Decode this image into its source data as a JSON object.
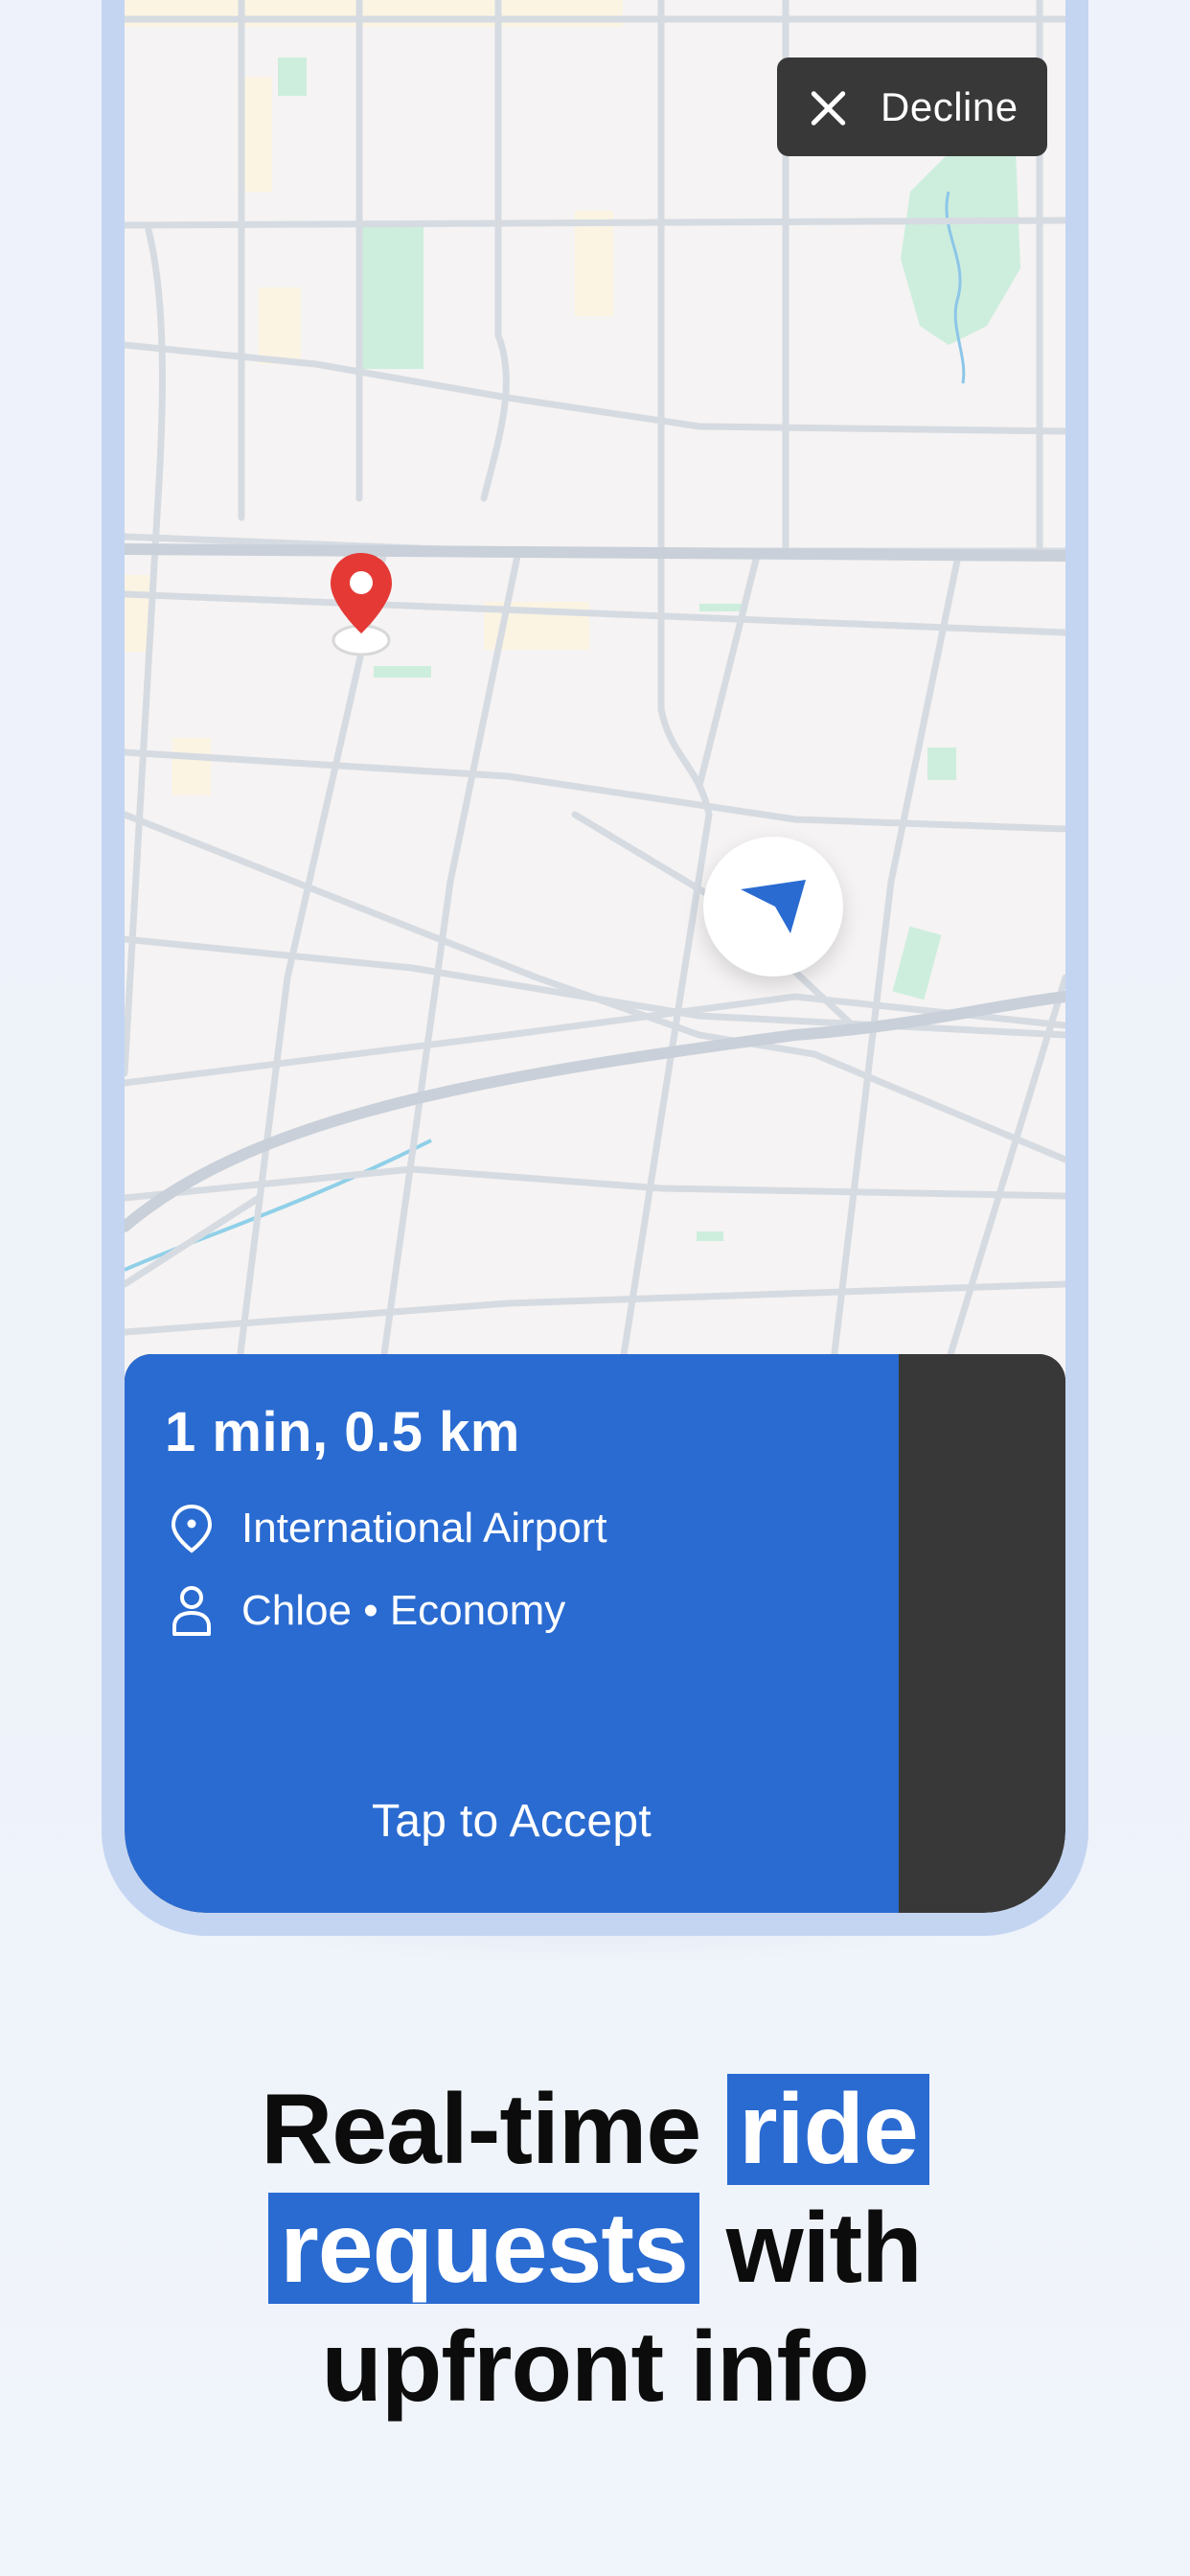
{
  "map": {
    "decline_label": "Decline",
    "icons": {
      "decline": "close-icon",
      "pickup_pin": "map-pin-icon",
      "recenter": "navigation-arrow-icon"
    }
  },
  "request_card": {
    "eta": "1 min, 0.5 km",
    "destination": "International Airport",
    "rider": "Chloe • Economy",
    "accept_label": "Tap to Accept",
    "icons": {
      "destination": "location-pin-icon",
      "rider": "person-icon"
    }
  },
  "headline": {
    "line1_plain": "Real-time",
    "line1_highlight": "ride",
    "line2_highlight": "requests",
    "line2_plain": "with",
    "line3": "upfront info"
  },
  "colors": {
    "accent": "#2a6bd1",
    "pin_red": "#e53935",
    "dark": "#383838",
    "frame": "#c4d5f2"
  }
}
